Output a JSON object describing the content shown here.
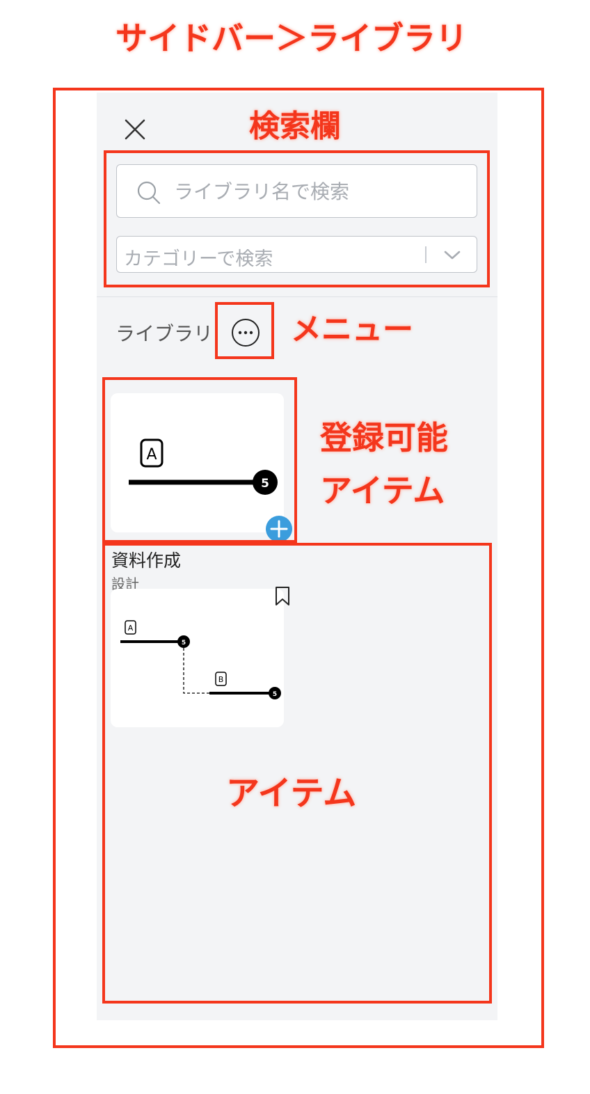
{
  "annotations": {
    "page_title": "サイドバー＞ライブラリ",
    "search_area": "検索欄",
    "menu": "メニュー",
    "registrable_line1": "登録可能",
    "registrable_line2": "アイテム",
    "items": "アイテム"
  },
  "sidebar": {
    "close_icon": "close-icon",
    "search": {
      "placeholder": "ライブラリ名で検索",
      "value": ""
    },
    "category": {
      "placeholder": "カテゴリーで検索"
    },
    "library_title": "ライブラリ",
    "more_icon": "ellipsis-icon"
  },
  "registrable_item": {
    "box_label": "A",
    "badge": "5",
    "add_icon": "plus-icon"
  },
  "library_item": {
    "title": "資料作成",
    "subtitle": "設計",
    "box_a": "A",
    "box_b": "B",
    "badge_1": "5",
    "badge_2": "5",
    "bookmark_icon": "bookmark-icon"
  },
  "colors": {
    "annotation_red": "#f4361c",
    "panel_bg": "#f3f4f6",
    "add_blue": "#3b9ddd"
  }
}
